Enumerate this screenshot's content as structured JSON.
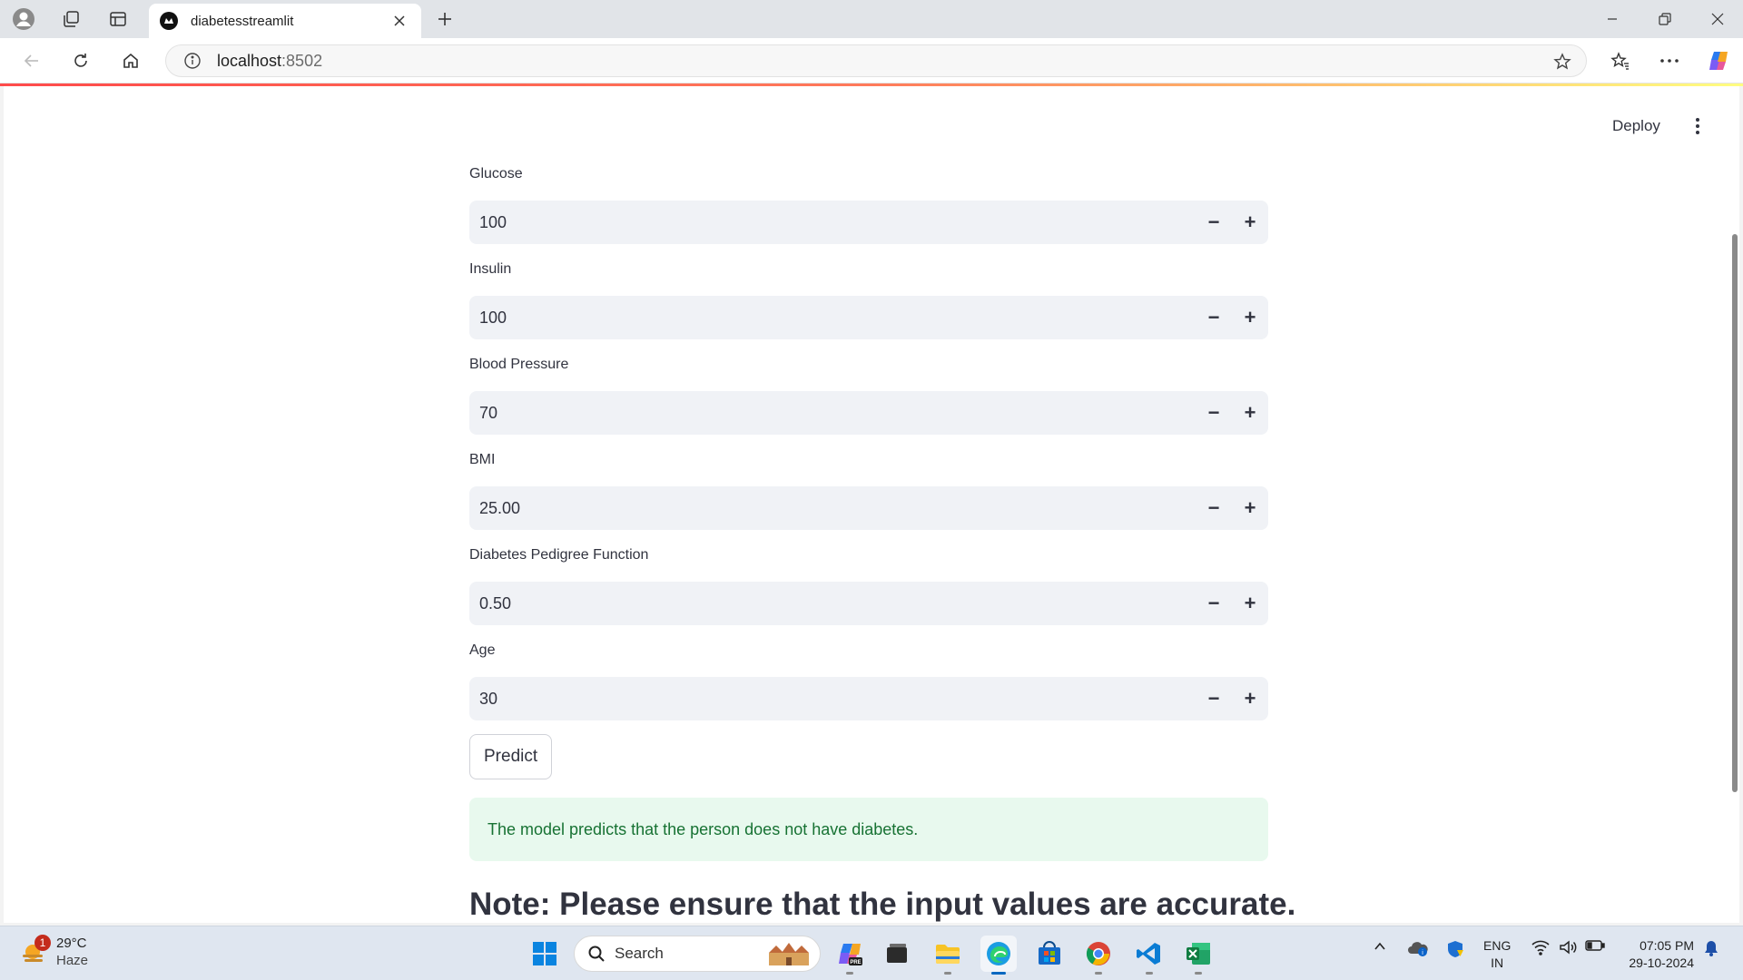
{
  "browser": {
    "tab_title": "diabetesstreamlit",
    "url_host": "localhost",
    "url_port": ":8502"
  },
  "app": {
    "deploy_label": "Deploy",
    "fields": [
      {
        "label": "Glucose",
        "value": "100"
      },
      {
        "label": "Insulin",
        "value": "100"
      },
      {
        "label": "Blood Pressure",
        "value": "70"
      },
      {
        "label": "BMI",
        "value": "25.00"
      },
      {
        "label": "Diabetes Pedigree Function",
        "value": "0.50"
      },
      {
        "label": "Age",
        "value": "30"
      }
    ],
    "stepper_minus": "−",
    "stepper_plus": "+",
    "predict_label": "Predict",
    "result_message": "The model predicts that the person does not have diabetes.",
    "note_heading": "Note: Please ensure that the input values are accurate."
  },
  "taskbar": {
    "weather_temp": "29°C",
    "weather_condition": "Haze",
    "weather_badge": "1",
    "search_label": "Search",
    "lang_top": "ENG",
    "lang_bottom": "IN",
    "time": "07:05 PM",
    "date": "29-10-2024"
  },
  "colors": {
    "accent_red": "#ff4b4b",
    "success_bg": "#e8f9ee",
    "success_text": "#177233",
    "input_bg": "#f0f2f6"
  }
}
